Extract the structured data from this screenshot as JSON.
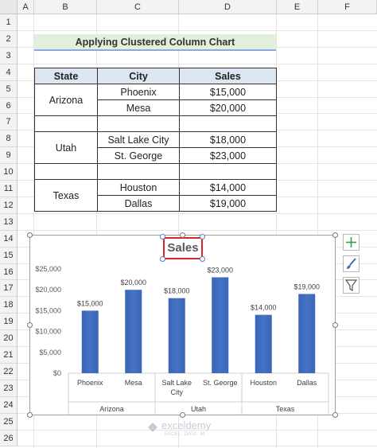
{
  "columns": [
    "A",
    "B",
    "C",
    "D",
    "E",
    "F"
  ],
  "rows": [
    "1",
    "2",
    "3",
    "4",
    "5",
    "6",
    "7",
    "8",
    "9",
    "10",
    "11",
    "12",
    "13",
    "14",
    "15",
    "16",
    "17",
    "18",
    "19",
    "20",
    "21",
    "22",
    "23",
    "24",
    "25",
    "26"
  ],
  "sheet_title": "Applying Clustered Column Chart",
  "table": {
    "headers": [
      "State",
      "City",
      "Sales"
    ],
    "groups": [
      {
        "state": "Arizona",
        "rows": [
          {
            "city": "Phoenix",
            "sales": "$15,000"
          },
          {
            "city": "Mesa",
            "sales": "$20,000"
          }
        ]
      },
      {
        "state": "Utah",
        "rows": [
          {
            "city": "Salt Lake City",
            "sales": "$18,000"
          },
          {
            "city": "St. George",
            "sales": "$23,000"
          }
        ]
      },
      {
        "state": "Texas",
        "rows": [
          {
            "city": "Houston",
            "sales": "$14,000"
          },
          {
            "city": "Dallas",
            "sales": "$19,000"
          }
        ]
      }
    ]
  },
  "chart_data": {
    "type": "bar",
    "title": "Sales",
    "categories": [
      "Phoenix",
      "Mesa",
      "Salt Lake City",
      "St. George",
      "Houston",
      "Dallas"
    ],
    "groups": [
      "Arizona",
      "Arizona",
      "Utah",
      "Utah",
      "Texas",
      "Texas"
    ],
    "group_labels": [
      "Arizona",
      "Utah",
      "Texas"
    ],
    "values": [
      15000,
      20000,
      18000,
      23000,
      14000,
      19000
    ],
    "data_labels": [
      "$15,000",
      "$20,000",
      "$18,000",
      "$23,000",
      "$14,000",
      "$19,000"
    ],
    "ylim": [
      0,
      25000
    ],
    "yticks": [
      "$0",
      "$5,000",
      "$10,000",
      "$15,000",
      "$20,000",
      "$25,000"
    ],
    "bar_color": "#4472c4",
    "grid": false
  },
  "side_buttons": [
    "plus-icon",
    "brush-icon",
    "filter-icon"
  ],
  "watermark": {
    "name": "exceldemy",
    "tagline": "EXCEL · DATA · BI"
  }
}
